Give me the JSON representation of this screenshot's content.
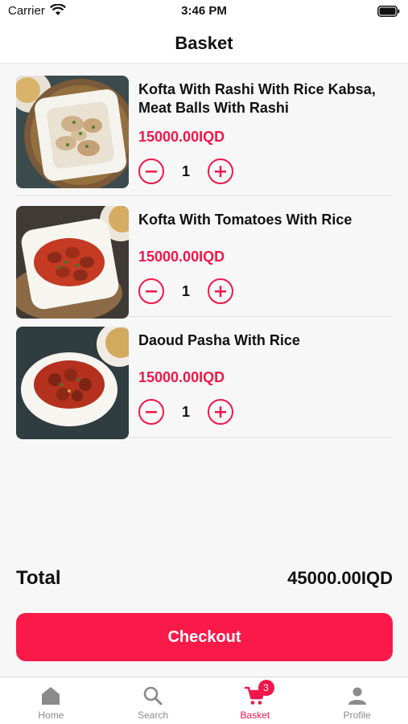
{
  "status_bar": {
    "carrier": "Carrier",
    "time": "3:46 PM"
  },
  "nav": {
    "title": "Basket"
  },
  "items": [
    {
      "name": "Kofta With Rashi With Rice Kabsa, Meat Balls With Rashi",
      "price": "15000.00IQD",
      "quantity": "1"
    },
    {
      "name": "Kofta With Tomatoes With Rice",
      "price": "15000.00IQD",
      "quantity": "1"
    },
    {
      "name": "Daoud Pasha With Rice",
      "price": "15000.00IQD",
      "quantity": "1"
    }
  ],
  "total": {
    "label": "Total",
    "value": "45000.00IQD"
  },
  "checkout": {
    "label": "Checkout"
  },
  "tabs": [
    {
      "label": "Home",
      "icon": "home-icon"
    },
    {
      "label": "Search",
      "icon": "search-icon"
    },
    {
      "label": "Basket",
      "icon": "cart-icon",
      "badge": "3",
      "active": true
    },
    {
      "label": "Profile",
      "icon": "profile-icon"
    }
  ],
  "colors": {
    "accent": "#f2164a",
    "button": "#fa1a4a",
    "inactive": "#8a8a8a"
  }
}
